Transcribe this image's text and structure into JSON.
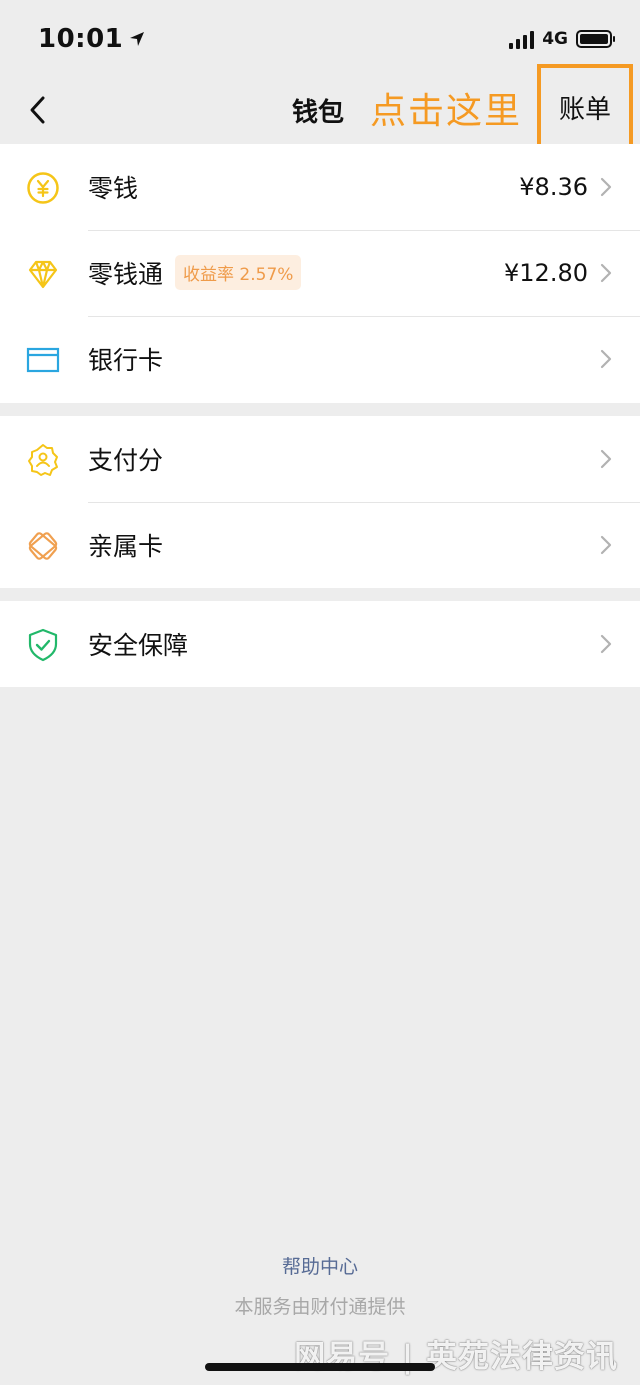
{
  "status_bar": {
    "time": "10:01",
    "network": "4G"
  },
  "nav": {
    "title": "钱包",
    "annotation": "点击这里",
    "bill_label": "账单"
  },
  "groups": [
    [
      {
        "label": "零钱",
        "value": "¥8.36",
        "icon": "yuan-coin-icon"
      },
      {
        "label": "零钱通",
        "badge": "收益率 2.57%",
        "value": "¥12.80",
        "icon": "diamond-icon"
      },
      {
        "label": "银行卡",
        "icon": "bank-card-icon"
      }
    ],
    [
      {
        "label": "支付分",
        "icon": "badge-person-icon"
      },
      {
        "label": "亲属卡",
        "icon": "family-card-icon"
      }
    ],
    [
      {
        "label": "安全保障",
        "icon": "shield-check-icon"
      }
    ]
  ],
  "footer": {
    "help": "帮助中心",
    "provider": "本服务由财付通提供"
  },
  "watermark": "网易号 | 英苑法律资讯",
  "colors": {
    "accent": "#f59a23",
    "link": "#576b95",
    "yellow": "#f5c518",
    "blue": "#2aa6e0",
    "orange": "#f0a050",
    "green": "#22b86a"
  }
}
